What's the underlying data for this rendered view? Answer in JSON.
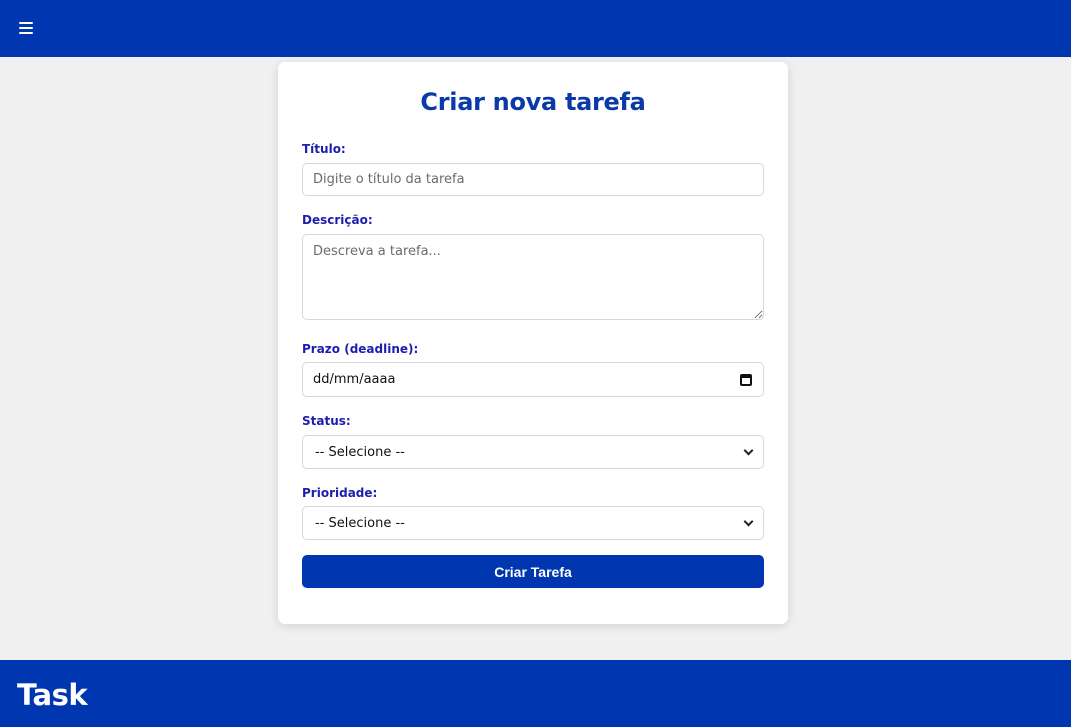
{
  "header": {
    "menu_icon": "hamburger-menu-icon"
  },
  "form": {
    "title": "Criar nova tarefa",
    "titulo": {
      "label": "Título:",
      "placeholder": "Digite o título da tarefa"
    },
    "descricao": {
      "label": "Descrição:",
      "placeholder": "Descreva a tarefa..."
    },
    "prazo": {
      "label": "Prazo (deadline):",
      "value": "dd/mm/aaaa",
      "icon": "calendar-icon"
    },
    "status": {
      "label": "Status:",
      "selected": "-- Selecione --"
    },
    "prioridade": {
      "label": "Prioridade:",
      "selected": "-- Selecione --"
    },
    "submit_label": "Criar Tarefa"
  },
  "footer": {
    "brand": "Task"
  },
  "colors": {
    "primary": "#0037b0",
    "background": "#f0f0f0",
    "label": "#1d1db0",
    "title": "#0a3aa8"
  }
}
